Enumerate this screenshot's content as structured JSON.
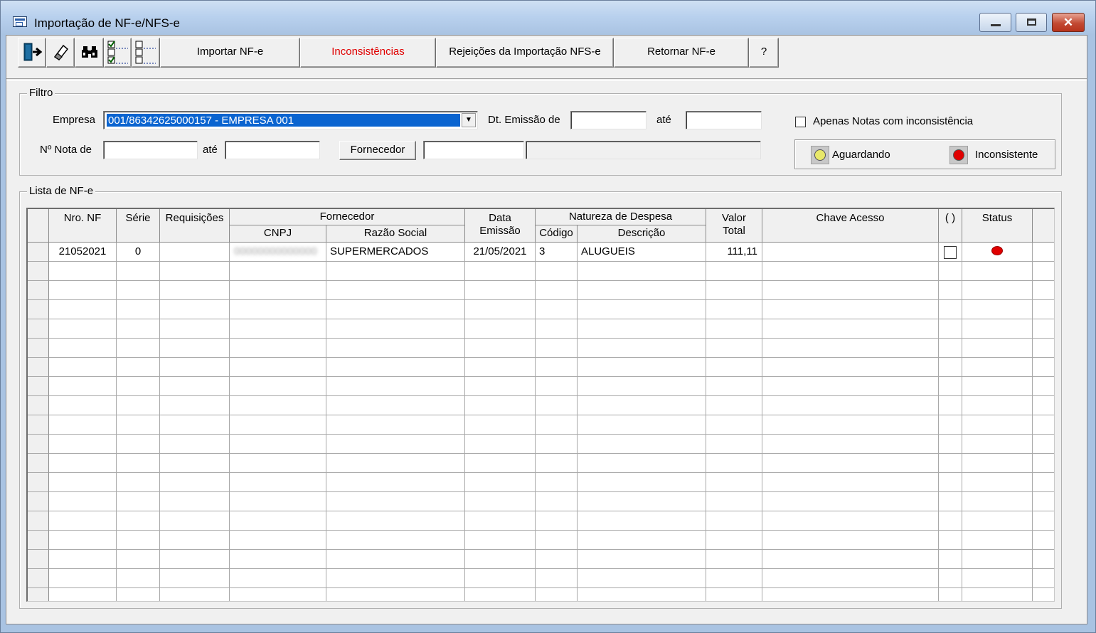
{
  "window": {
    "title": "Importação de NF-e/NFS-e",
    "close_glyph": "✕"
  },
  "toolbar": {
    "icon_buttons": [
      {
        "name": "exit-icon"
      },
      {
        "name": "eraser-icon"
      },
      {
        "name": "binoculars-icon"
      },
      {
        "name": "check-all-icon"
      },
      {
        "name": "uncheck-all-icon"
      }
    ],
    "importar": "Importar NF-e",
    "inconsistencias": "Inconsistências",
    "rejeicoes": "Rejeições da Importação NFS-e",
    "retornar": "Retornar NF-e",
    "help": "?"
  },
  "filtro": {
    "group_label": "Filtro",
    "empresa_label": "Empresa",
    "empresa_value": "001/86342625000157 - EMPRESA 001",
    "dt_emissao_label": "Dt. Emissão de",
    "ate1": "até",
    "dt_emissao_de": "",
    "dt_emissao_ate": "",
    "nota_label": "Nº Nota de",
    "ate2": "até",
    "nota_de": "",
    "nota_ate": "",
    "fornecedor_button": "Fornecedor",
    "fornecedor_codigo": "",
    "fornecedor_nome": "",
    "apenas_label": "Apenas Notas com inconsistência",
    "apenas_checked": false,
    "legend_aguardando": "Aguardando",
    "legend_inconsistente": "Inconsistente",
    "color_aguardando": "#e8e86a",
    "color_inconsistente": "#e00000"
  },
  "lista": {
    "group_label": "Lista de NF-e",
    "headers": {
      "nro_nf": "Nro. NF",
      "serie": "Série",
      "requisicoes": "Requisições",
      "fornecedor": "Fornecedor",
      "cnpj": "CNPJ",
      "razao_social": "Razão Social",
      "data": "Data",
      "emissao": "Emissão",
      "natureza": "Natureza de Despesa",
      "codigo": "Código",
      "descricao": "Descrição",
      "valor": "Valor",
      "total": "Total",
      "chave": "Chave Acesso",
      "sel": "( )",
      "status": "Status"
    },
    "rows": [
      {
        "nro_nf": "21052021",
        "serie": "0",
        "requisicoes": "",
        "cnpj": "00000000000000",
        "razao_social": "SUPERMERCADOS",
        "data_emissao": "21/05/2021",
        "codigo": "3",
        "descricao": "ALUGUEIS",
        "valor_total": "111,11",
        "chave": "",
        "selected": false,
        "status": "inconsistente"
      }
    ]
  }
}
